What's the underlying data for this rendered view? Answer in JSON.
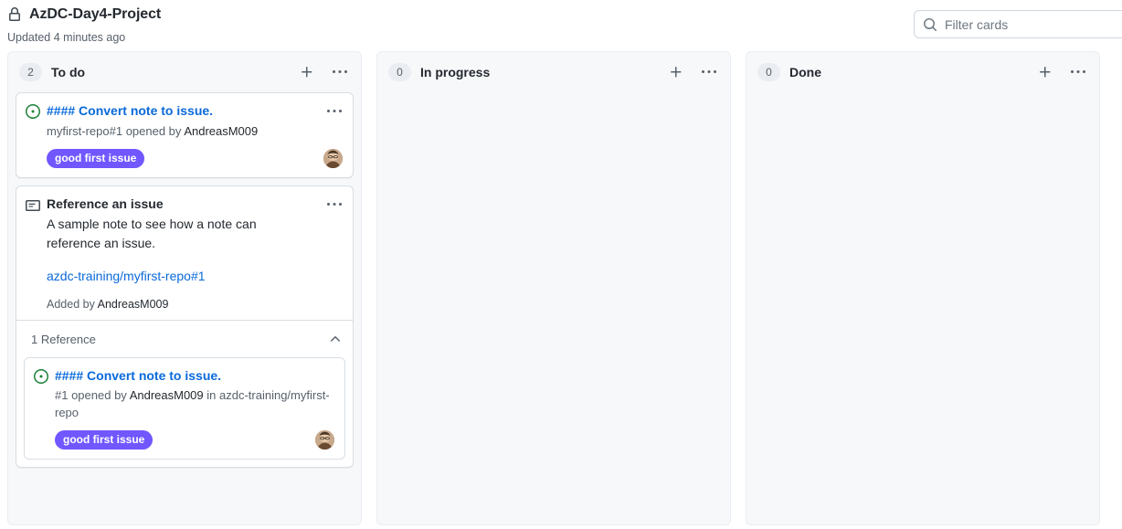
{
  "header": {
    "lock_icon": "lock-icon",
    "project_title": "AzDC-Day4-Project",
    "updated_text": "Updated 4 minutes ago",
    "filter": {
      "icon": "search-icon",
      "placeholder": "Filter cards",
      "value": ""
    }
  },
  "colors": {
    "label_good_first_issue": "#7057ff",
    "issue_open_green": "#1a7f37",
    "link_blue": "#0969da",
    "column_bg": "#f6f8fa",
    "text_muted": "#57606a"
  },
  "columns": [
    {
      "name": "To do",
      "count": "2",
      "add_icon": "plus-icon",
      "menu_icon": "kebab-horizontal-icon",
      "cards": [
        {
          "type": "issue",
          "state_icon": "issue-opened-icon",
          "title": "#### Convert note to issue.",
          "meta_prefix": "myfirst-repo#1 opened by ",
          "meta_actor": "AndreasM009",
          "label": "good first issue",
          "label_color": "#7057ff",
          "avatar": "avatar",
          "menu_icon": "kebab-horizontal-icon"
        },
        {
          "type": "note",
          "note_icon": "note-icon",
          "title": "Reference an issue",
          "body": "A sample note to see how a note can reference an issue.",
          "link": "azdc-training/myfirst-repo#1",
          "added_prefix": "Added by ",
          "added_actor": "AndreasM009",
          "menu_icon": "kebab-horizontal-icon",
          "reference_section": {
            "label": "1 Reference",
            "chevron_icon": "chevron-up-icon",
            "expanded": true,
            "items": [
              {
                "state_icon": "issue-opened-icon",
                "title": "#### Convert note to issue.",
                "meta_prefix": "#1 opened by ",
                "meta_actor": "AndreasM009",
                "meta_suffix": " in azdc-training/myfirst-repo",
                "label": "good first issue",
                "label_color": "#7057ff",
                "avatar": "avatar"
              }
            ]
          }
        }
      ]
    },
    {
      "name": "In progress",
      "count": "0",
      "add_icon": "plus-icon",
      "menu_icon": "kebab-horizontal-icon",
      "cards": []
    },
    {
      "name": "Done",
      "count": "0",
      "add_icon": "plus-icon",
      "menu_icon": "kebab-horizontal-icon",
      "cards": []
    }
  ]
}
